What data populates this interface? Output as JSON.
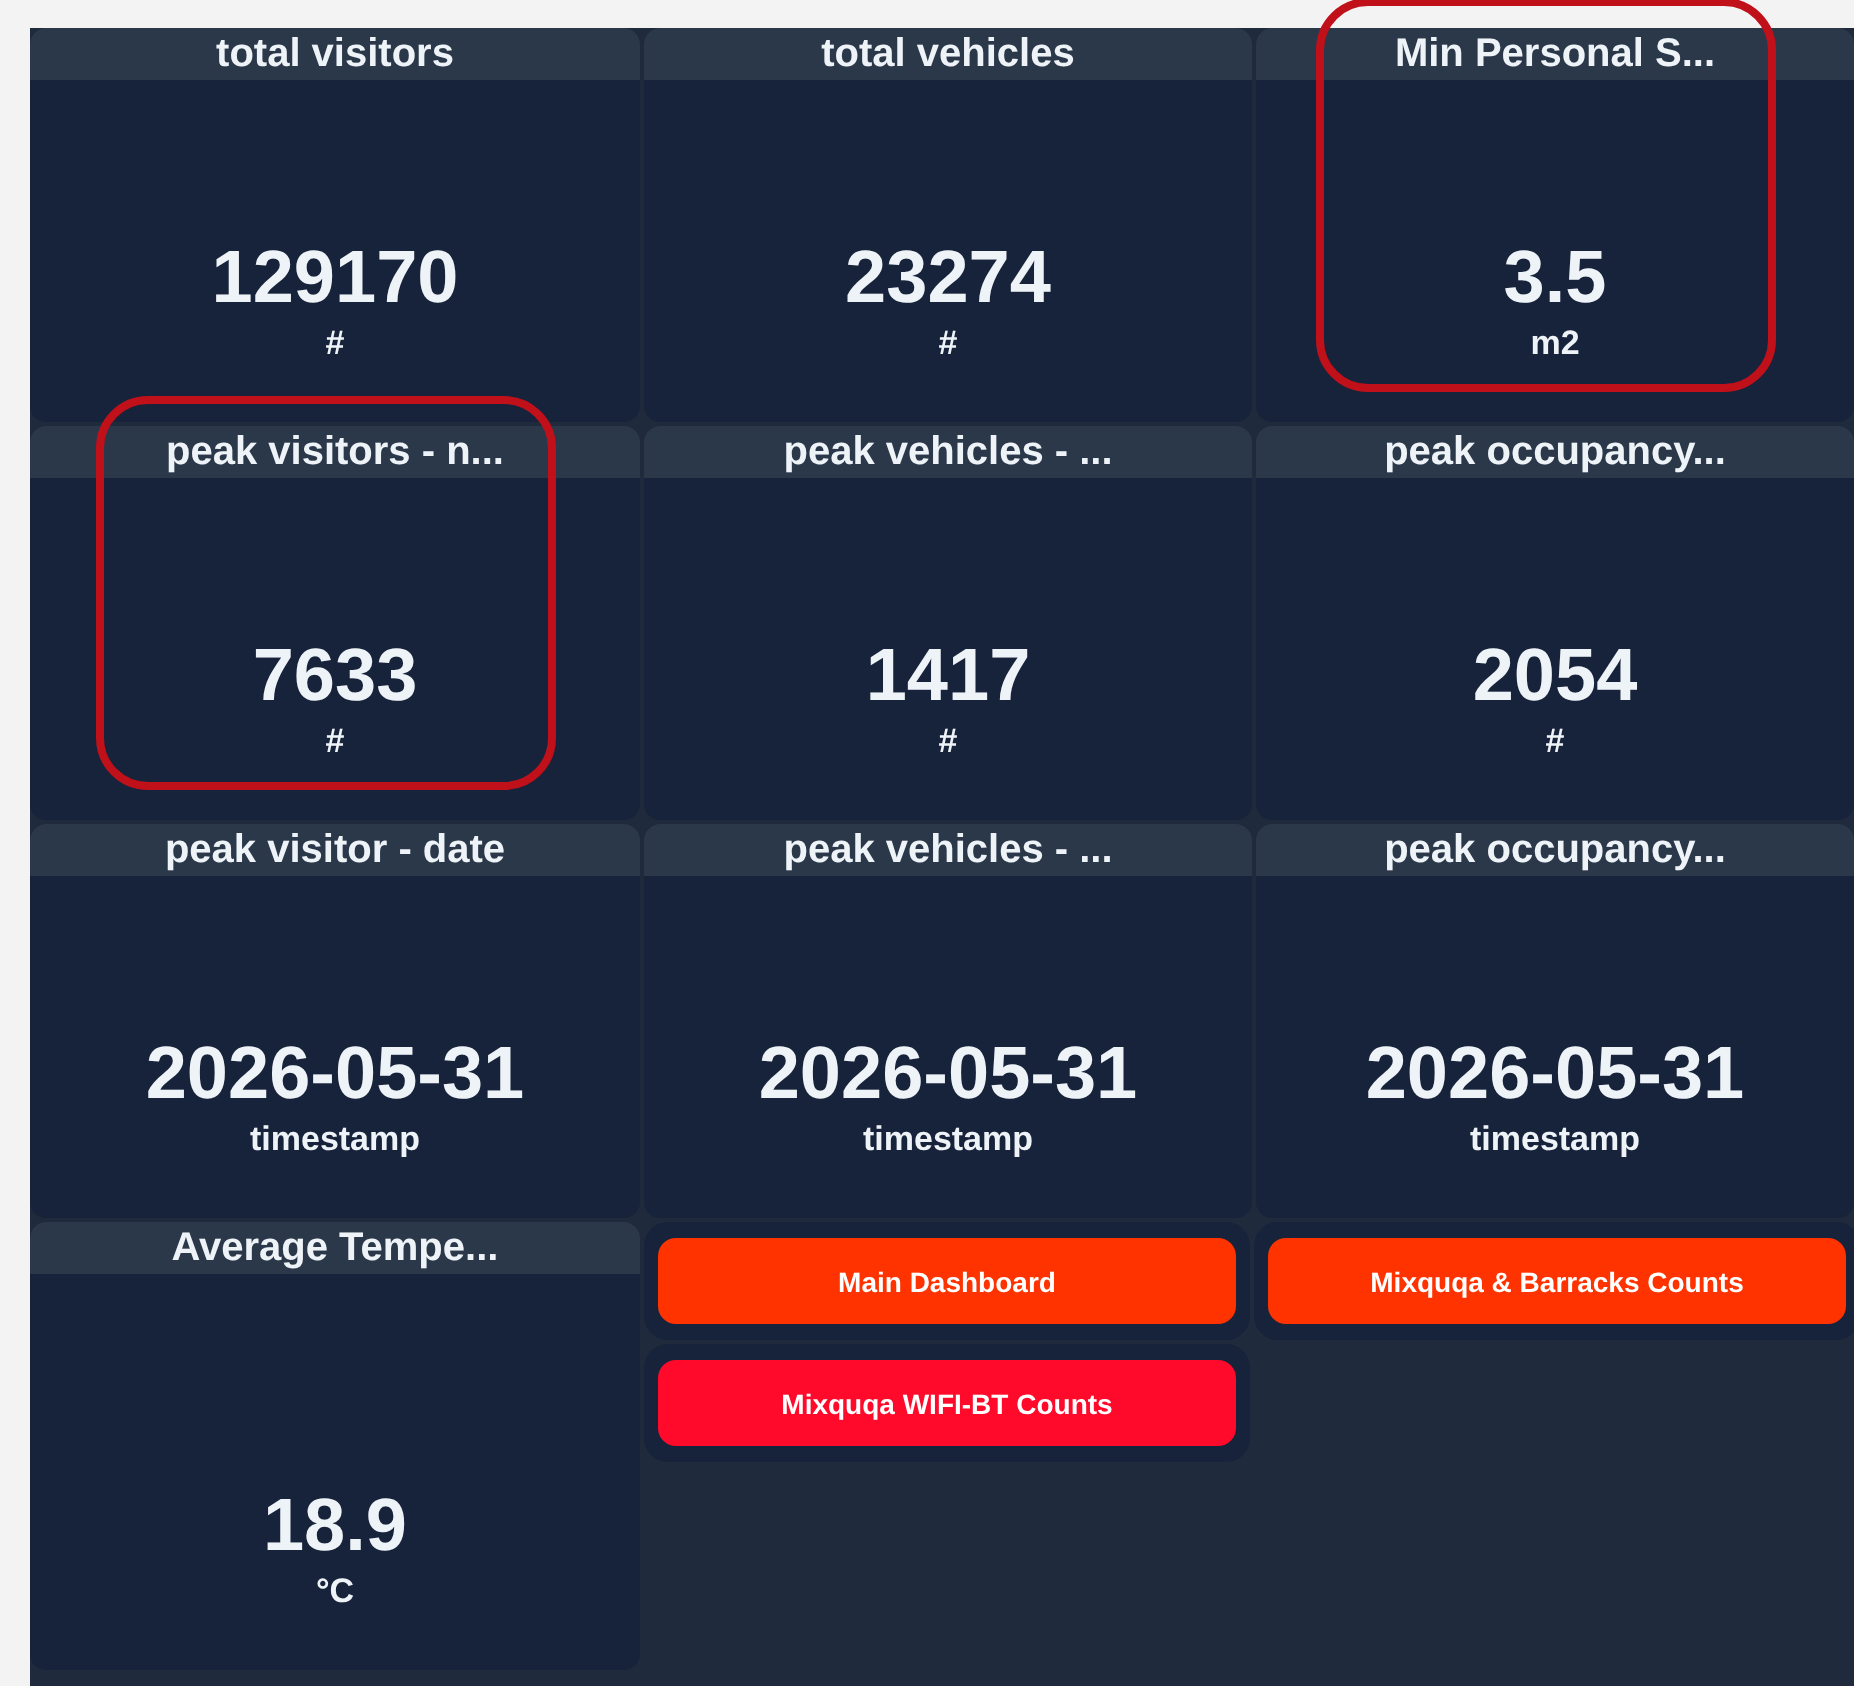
{
  "cards": [
    {
      "title": "total visitors",
      "value": "129170",
      "unit": "#",
      "highlighted": false
    },
    {
      "title": "total vehicles",
      "value": "23274",
      "unit": "#",
      "highlighted": false
    },
    {
      "title": "Min Personal S...",
      "value": "3.5",
      "unit": "m2",
      "highlighted": true
    },
    {
      "title": "peak visitors - n...",
      "value": "7633",
      "unit": "#",
      "highlighted": true
    },
    {
      "title": "peak vehicles - ...",
      "value": "1417",
      "unit": "#",
      "highlighted": false
    },
    {
      "title": "peak occupancy...",
      "value": "2054",
      "unit": "#",
      "highlighted": false
    },
    {
      "title": "peak visitor - date",
      "value": "2026-05-31",
      "unit": "timestamp",
      "highlighted": false
    },
    {
      "title": "peak vehicles - ...",
      "value": "2026-05-31",
      "unit": "timestamp",
      "highlighted": false
    },
    {
      "title": "peak occupancy...",
      "value": "2026-05-31",
      "unit": "timestamp",
      "highlighted": false
    },
    {
      "title": "Average Tempe...",
      "value": "18.9",
      "unit": "°C",
      "highlighted": false
    }
  ],
  "buttons": [
    {
      "label": "Main Dashboard",
      "color": "#ff3300"
    },
    {
      "label": "Mixquqa & Barracks Counts",
      "color": "#ff3300"
    },
    {
      "label": "Mixquqa WIFI-BT Counts",
      "color": "#ff0a2a"
    }
  ]
}
